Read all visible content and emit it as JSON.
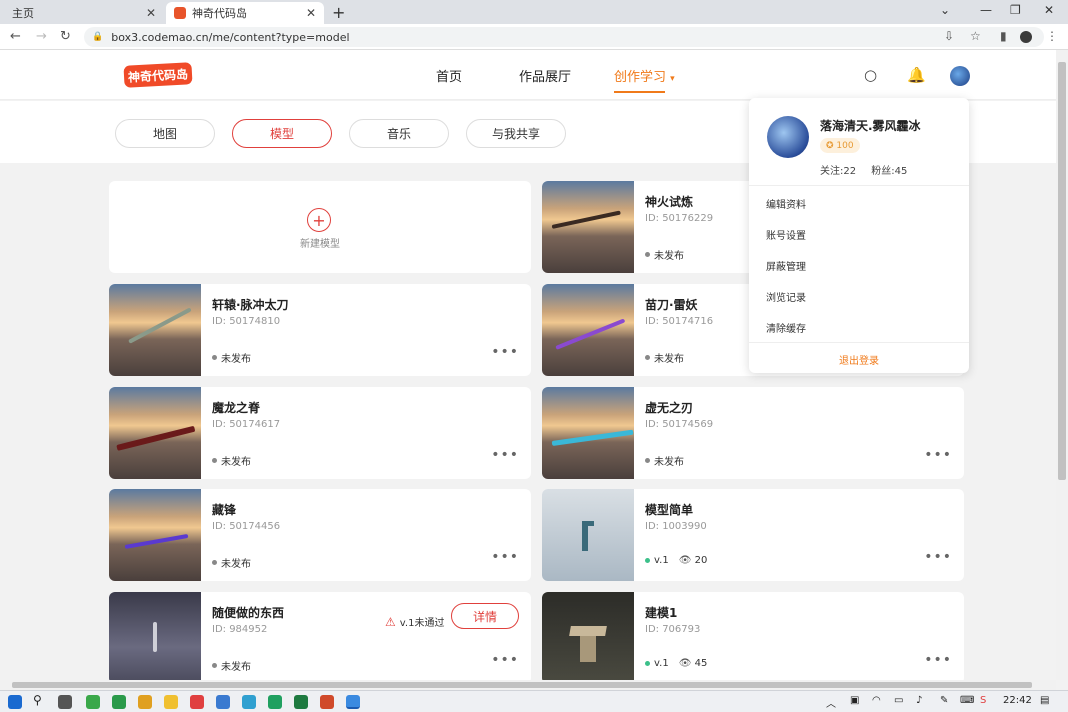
{
  "browser": {
    "tabs": [
      {
        "label": "主页"
      },
      {
        "label": "神奇代码岛"
      }
    ],
    "url": "box3.codemao.cn/me/content?type=model"
  },
  "header": {
    "logo": "神奇代码岛",
    "nav": [
      {
        "label": "首页"
      },
      {
        "label": "作品展厅"
      },
      {
        "label": "创作学习"
      }
    ]
  },
  "filters": [
    {
      "label": "地图"
    },
    {
      "label": "模型"
    },
    {
      "label": "音乐"
    },
    {
      "label": "与我共享"
    }
  ],
  "new_model": {
    "label": "新建模型"
  },
  "cards": [
    {
      "title": "神火试炼",
      "id": "ID: 50176229",
      "status": "未发布"
    },
    {
      "title": "轩辕·脉冲太刀",
      "id": "ID: 50174810",
      "status": "未发布"
    },
    {
      "title": "苗刀·雷妖",
      "id": "ID: 50174716",
      "status": "未发布"
    },
    {
      "title": "魔龙之脊",
      "id": "ID: 50174617",
      "status": "未发布"
    },
    {
      "title": "虚无之刃",
      "id": "ID: 50174569",
      "status": "未发布"
    },
    {
      "title": "藏锋",
      "id": "ID: 50174456",
      "status": "未发布"
    },
    {
      "title": "模型简单",
      "id": "ID: 1003990",
      "status": "v.1",
      "views": "20"
    },
    {
      "title": "随便做的东西",
      "id": "ID: 984952",
      "status": "未发布",
      "warning": "v.1未通过",
      "action": "详情"
    },
    {
      "title": "建模1",
      "id": "ID: 706793",
      "status": "v.1",
      "views": "45"
    }
  ],
  "more_label": "•••",
  "user_menu": {
    "name": "落海清天.雾风霾冰",
    "badge": "100",
    "following": "关注:22",
    "followers": "粉丝:45",
    "items": [
      {
        "label": "编辑资料"
      },
      {
        "label": "账号设置"
      },
      {
        "label": "屏蔽管理"
      },
      {
        "label": "浏览记录"
      },
      {
        "label": "清除缓存"
      }
    ],
    "logout": "退出登录"
  },
  "taskbar": {
    "time": "22:42"
  },
  "colors": {
    "accent": "#f07a1a",
    "red": "#e0403c"
  }
}
